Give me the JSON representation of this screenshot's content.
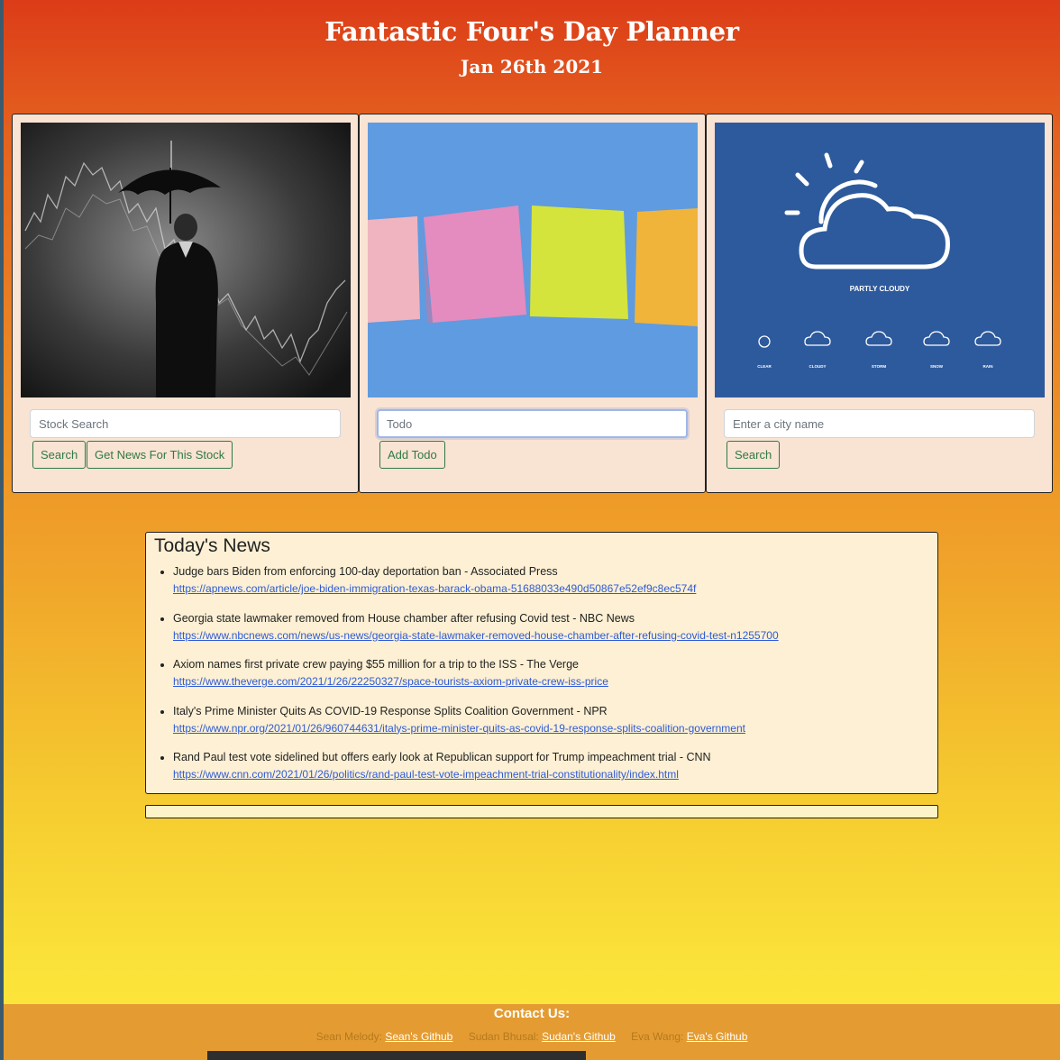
{
  "header": {
    "title": "Fantastic Four's Day Planner",
    "date": "Jan 26th 2021"
  },
  "stock": {
    "input_placeholder": "Stock Search",
    "search_label": "Search",
    "news_label": "Get News For This Stock"
  },
  "todo": {
    "input_placeholder": "Todo",
    "add_label": "Add Todo"
  },
  "weather": {
    "input_placeholder": "Enter a city name",
    "search_label": "Search",
    "image_text": {
      "main": "PARTLY CLOUDY",
      "icons": [
        "CLEAR",
        "CLOUDY",
        "STORM",
        "SNOW",
        "RAIN"
      ]
    }
  },
  "news": {
    "heading": "Today's News",
    "items": [
      {
        "title": "Judge bars Biden from enforcing 100-day deportation ban - Associated Press",
        "url": "https://apnews.com/article/joe-biden-immigration-texas-barack-obama-51688033e490d50867e52ef9c8ec574f"
      },
      {
        "title": "Georgia state lawmaker removed from House chamber after refusing Covid test - NBC News",
        "url": "https://www.nbcnews.com/news/us-news/georgia-state-lawmaker-removed-house-chamber-after-refusing-covid-test-n1255700"
      },
      {
        "title": "Axiom names first private crew paying $55 million for a trip to the ISS - The Verge",
        "url": "https://www.theverge.com/2021/1/26/22250327/space-tourists-axiom-private-crew-iss-price"
      },
      {
        "title": "Italy's Prime Minister Quits As COVID-19 Response Splits Coalition Government - NPR",
        "url": "https://www.npr.org/2021/01/26/960744631/italys-prime-minister-quits-as-covid-19-response-splits-coalition-government"
      },
      {
        "title": "Rand Paul test vote sidelined but offers early look at Republican support for Trump impeachment trial - CNN",
        "url": "https://www.cnn.com/2021/01/26/politics/rand-paul-test-vote-impeachment-trial-constitutionality/index.html"
      }
    ]
  },
  "footer": {
    "contact": "Contact Us:",
    "people": [
      {
        "name": "Sean Melody:",
        "link": "Sean's Github"
      },
      {
        "name": "Sudan Bhusal:",
        "link": "Sudan's Github"
      },
      {
        "name": "Eva Wang:",
        "link": "Eva's Github"
      }
    ]
  }
}
